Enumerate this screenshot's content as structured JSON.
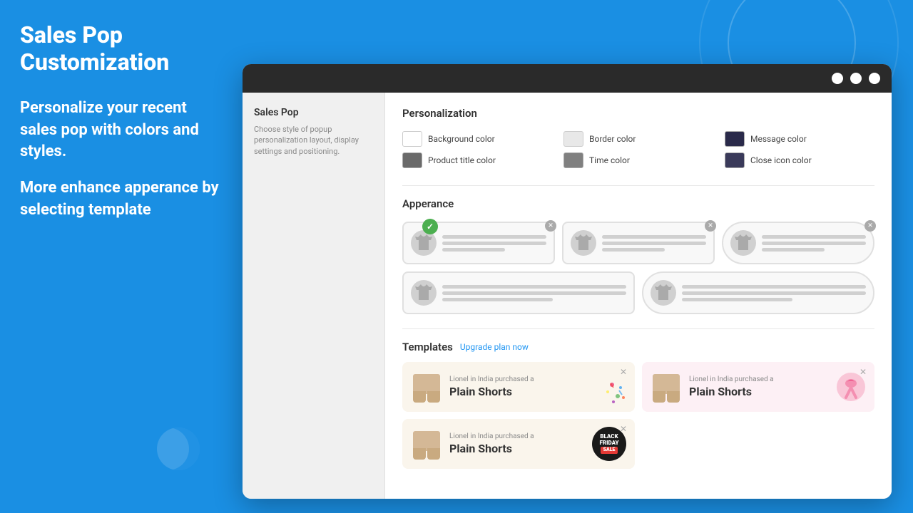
{
  "page": {
    "title": "Sales Pop Customization",
    "description1": "Personalize your recent sales pop with colors and styles.",
    "description2": "More enhance apperance by selecting template"
  },
  "sidebar": {
    "title": "Sales Pop",
    "description": "Choose style of popup personalization layout, display settings and positioning."
  },
  "personalization": {
    "section_title": "Personalization",
    "colors": [
      {
        "label": "Background color",
        "swatch": "#ffffff",
        "border": "#ccc"
      },
      {
        "label": "Border color",
        "swatch": "#e8e8e8",
        "border": "#ccc"
      },
      {
        "label": "Message color",
        "swatch": "#2a2a4a",
        "border": "#ccc"
      },
      {
        "label": "Product title color",
        "swatch": "#5a5a5a",
        "border": "#ccc"
      },
      {
        "label": "Time color",
        "swatch": "#7a7a7a",
        "border": "#ccc"
      },
      {
        "label": "Close icon color",
        "swatch": "#3a3a5a",
        "border": "#ccc"
      }
    ]
  },
  "appearance": {
    "section_title": "Apperance",
    "templates": [
      {
        "id": 1,
        "selected": true,
        "rounded": false
      },
      {
        "id": 2,
        "selected": false,
        "rounded": false
      },
      {
        "id": 3,
        "selected": false,
        "rounded": true
      },
      {
        "id": 4,
        "selected": false,
        "rounded": false
      },
      {
        "id": 5,
        "selected": false,
        "rounded": true
      }
    ]
  },
  "templates": {
    "section_title": "Templates",
    "upgrade_label": "Upgrade plan now",
    "items": [
      {
        "id": 1,
        "purchased_text": "Lionel in India purchased a",
        "product_name": "Plain Shorts",
        "bg": "warm",
        "badge_type": "confetti"
      },
      {
        "id": 2,
        "purchased_text": "Lionel in India purchased a",
        "product_name": "Plain Shorts",
        "bg": "pink",
        "badge_type": "pink-sticker"
      },
      {
        "id": 3,
        "purchased_text": "Lionel in India purchased a",
        "product_name": "Plain Shorts",
        "bg": "warm",
        "badge_type": "black-friday"
      }
    ]
  },
  "browser": {
    "dots": [
      "dot1",
      "dot2",
      "dot3"
    ]
  }
}
